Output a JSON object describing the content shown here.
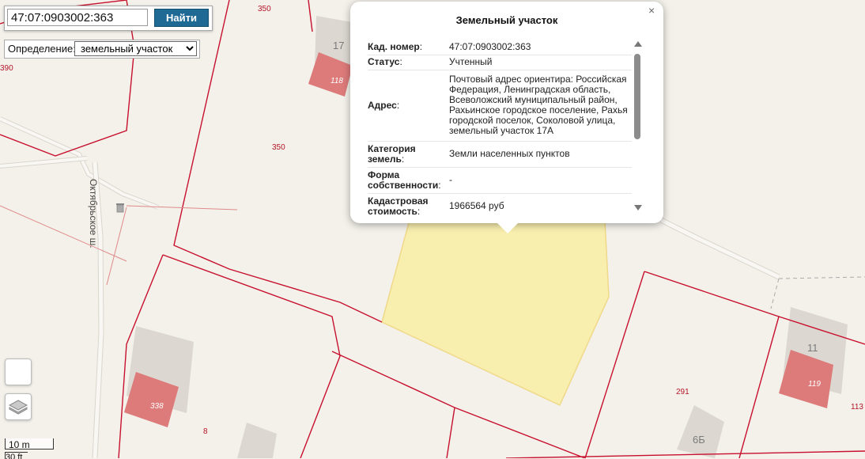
{
  "search": {
    "value": "47:07:0903002:363",
    "button_label": "Найти"
  },
  "definition": {
    "label": "Определение:",
    "selected": "земельный участок"
  },
  "map": {
    "street_name": "Октябрьское ш.",
    "parcel_labels": [
      "350",
      "350",
      "390",
      "291",
      "113",
      "8"
    ],
    "building_labels": [
      "118",
      "338",
      "119"
    ],
    "house_numbers": [
      "17",
      "11",
      "6Б"
    ]
  },
  "scale": {
    "metric": "10 m",
    "imperial": "30 ft"
  },
  "popup": {
    "title": "Земельный участок",
    "close_glyph": "×",
    "rows": [
      {
        "key": "Кад. номер",
        "value": "47:07:0903002:363"
      },
      {
        "key": "Статус",
        "value": "Учтенный"
      },
      {
        "key": "Адрес",
        "value": "Почтовый адрес ориентира: Российская Федерация, Ленинградская область, Всеволожский муниципальный район, Рахьинское городское поселение, Рахья городской поселок, Соколовой улица, земельный участок 17А"
      },
      {
        "key": "Категория земель",
        "value": "Земли населенных пунктов"
      },
      {
        "key": "Форма собственности",
        "value": "-"
      },
      {
        "key": "Кадастровая стоимость",
        "value": "1966564 руб"
      }
    ]
  },
  "colors": {
    "parcel_line": "#c8102e",
    "selected_parcel": "#f8eeae",
    "building_red": "#dd7a7a",
    "button": "#1f6a95"
  },
  "icons": {
    "layers": "layers-icon",
    "trash": "trash-can-icon"
  }
}
